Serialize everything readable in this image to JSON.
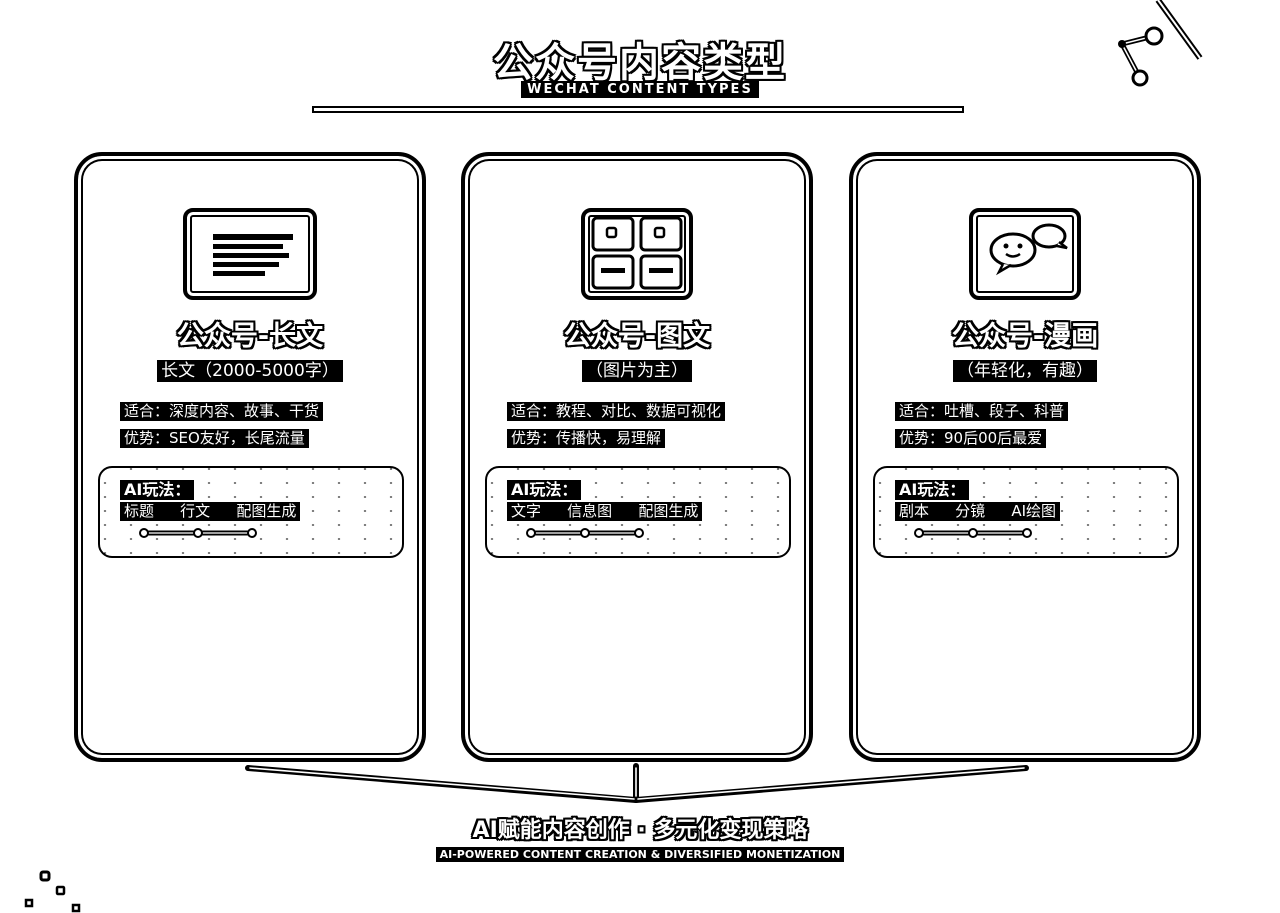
{
  "header": {
    "title": "公众号内容类型",
    "subtitle": "WECHAT CONTENT TYPES"
  },
  "cards": [
    {
      "title": "公众号-长文",
      "subtitle": "长文（2000-5000字）",
      "suitable": "适合：深度内容、故事、干货",
      "advantage": "优势：SEO友好，长尾流量",
      "ai_label": "AI玩法：",
      "flow": [
        "标题",
        "行文",
        "配图生成"
      ],
      "icon": "document-icon"
    },
    {
      "title": "公众号-图文",
      "subtitle": "（图片为主）",
      "suitable": "适合：教程、对比、数据可视化",
      "advantage": "优势：传播快，易理解",
      "ai_label": "AI玩法：",
      "flow": [
        "文字",
        "信息图",
        "配图生成"
      ],
      "icon": "grid-icon"
    },
    {
      "title": "公众号-漫画",
      "subtitle": "（年轻化，有趣）",
      "suitable": "适合：吐槽、段子、科普",
      "advantage": "优势：90后00后最爱",
      "ai_label": "AI玩法：",
      "flow": [
        "剧本",
        "分镜",
        "AI绘图"
      ],
      "icon": "comic-icon"
    }
  ],
  "footer": {
    "title": "AI赋能内容创作 · 多元化变现策略",
    "subtitle": "AI-POWERED CONTENT CREATION & DIVERSIFIED MONETIZATION"
  }
}
